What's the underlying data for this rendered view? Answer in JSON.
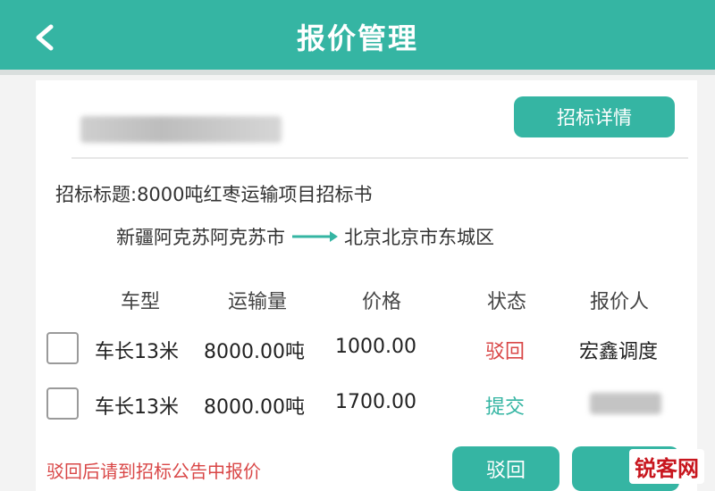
{
  "header": {
    "title": "报价管理",
    "back_icon": "chevron-left-icon",
    "color": "#35b5a3"
  },
  "tender": {
    "detail_button_label": "招标详情",
    "title": "招标标题:8000吨红枣运输项目招标书",
    "route_from": "新疆阿克苏阿克苏市",
    "route_to": "北京北京市东城区"
  },
  "table": {
    "headers": [
      "车型",
      "运输量",
      "价格",
      "状态",
      "报价人"
    ],
    "rows": [
      {
        "vehicle": "车长13米",
        "volume": "8000.00吨",
        "price": "1000.00",
        "status": "驳回",
        "quoter": "宏鑫调度"
      },
      {
        "vehicle": "车长13米",
        "volume": "8000.00吨",
        "price": "1700.00",
        "status": "提交",
        "quoter": ""
      }
    ]
  },
  "footer": {
    "note": "驳回后请到招标公告中报价",
    "reject_button_label": "驳回",
    "status_colors": {
      "rejected": "#d94747",
      "submitted": "#35b5a3"
    }
  },
  "watermark": {
    "text": "锐客网"
  }
}
